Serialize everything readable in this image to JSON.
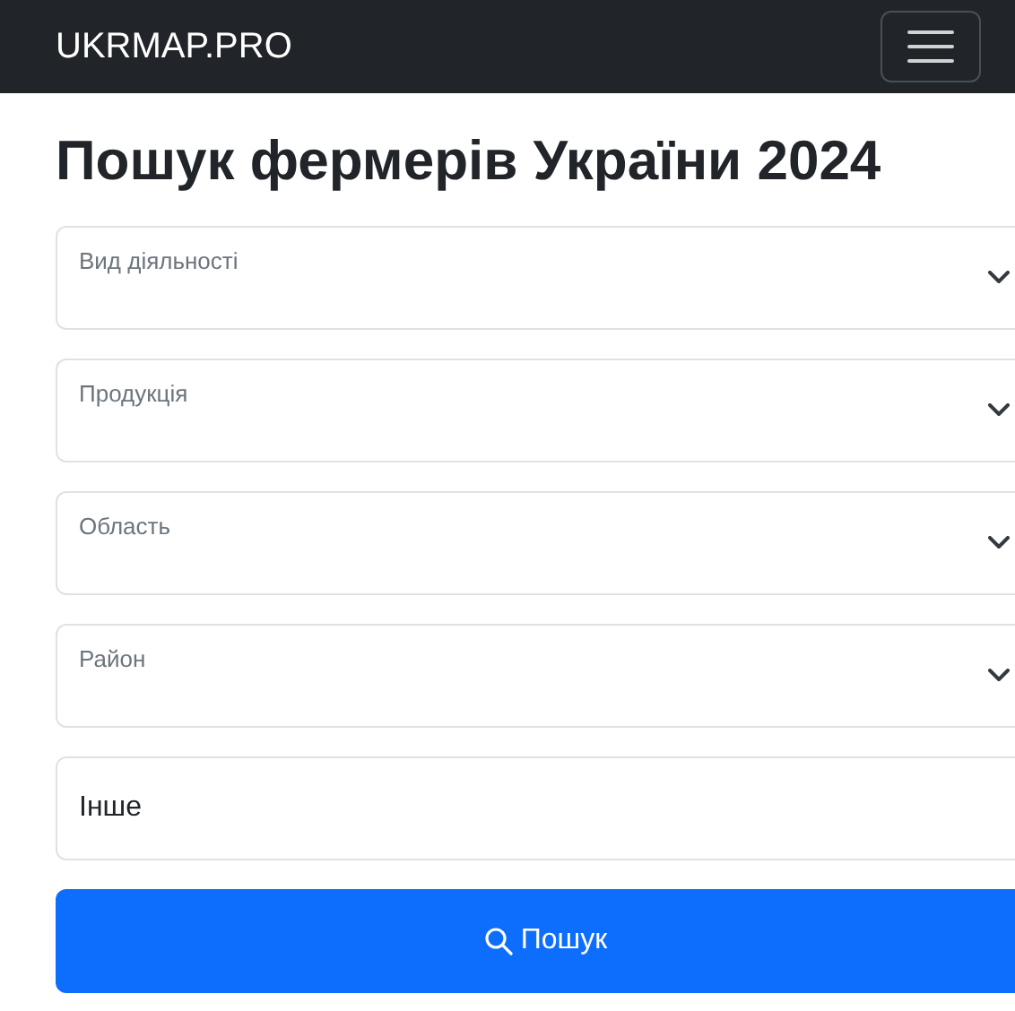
{
  "navbar": {
    "brand": "UKRMAP.PRO"
  },
  "heading": "Пошук фермерів України 2024",
  "selects": [
    {
      "label": "Вид діяльності"
    },
    {
      "label": "Продукція"
    },
    {
      "label": "Область"
    },
    {
      "label": "Район"
    }
  ],
  "other_field": {
    "label": "Інше"
  },
  "search_button": {
    "label": "Пошук"
  }
}
